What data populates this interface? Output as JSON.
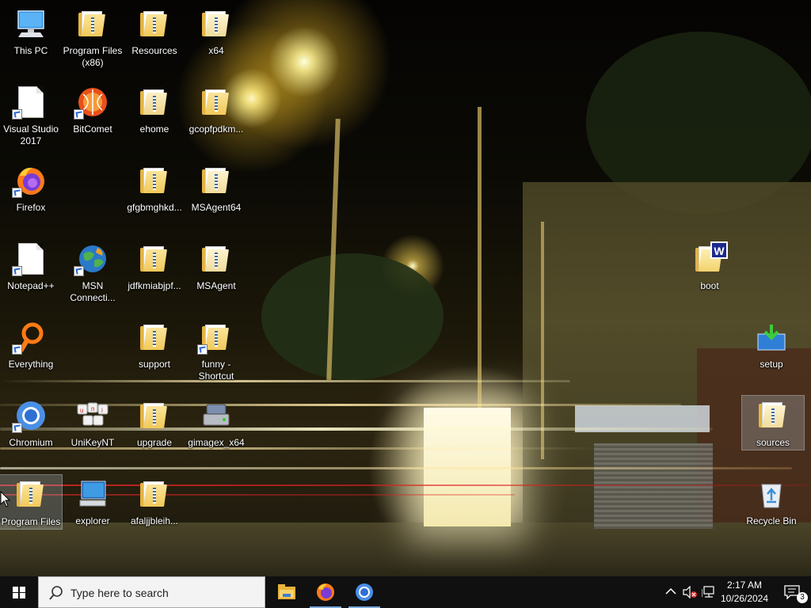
{
  "desktop": {
    "icons": [
      {
        "label": "This PC"
      },
      {
        "label": "Program Files (x86)"
      },
      {
        "label": "Resources"
      },
      {
        "label": "x64"
      },
      {
        "label": "Visual Studio 2017"
      },
      {
        "label": "BitComet"
      },
      {
        "label": "ehome"
      },
      {
        "label": "gcopfpdkm..."
      },
      {
        "label": "Firefox"
      },
      {
        "label": "gfgbmghkd..."
      },
      {
        "label": "MSAgent64"
      },
      {
        "label": "Notepad++"
      },
      {
        "label": "MSN Connecti..."
      },
      {
        "label": "jdfkmiabjpf..."
      },
      {
        "label": "MSAgent"
      },
      {
        "label": "boot"
      },
      {
        "label": "Everything"
      },
      {
        "label": "support"
      },
      {
        "label": "funny - Shortcut"
      },
      {
        "label": "setup"
      },
      {
        "label": "Chromium"
      },
      {
        "label": "UniKeyNT"
      },
      {
        "label": "upgrade"
      },
      {
        "label": "gimagex_x64"
      },
      {
        "label": "sources"
      },
      {
        "label": "Program Files"
      },
      {
        "label": "explorer"
      },
      {
        "label": "afaljjbleih..."
      },
      {
        "label": "Recycle Bin"
      }
    ]
  },
  "taskbar": {
    "search_placeholder": "Type here to search",
    "pinned": [
      {
        "name": "file-explorer",
        "active": false
      },
      {
        "name": "firefox",
        "active": true
      },
      {
        "name": "chromium",
        "active": true
      }
    ],
    "clock": {
      "time": "2:17 AM",
      "date": "10/26/2024"
    },
    "notifications_count": "3"
  },
  "colors": {
    "taskbar_bg": "#101010",
    "folder_yellow": "#f2c95a",
    "accent_blue": "#7aa7d8"
  }
}
